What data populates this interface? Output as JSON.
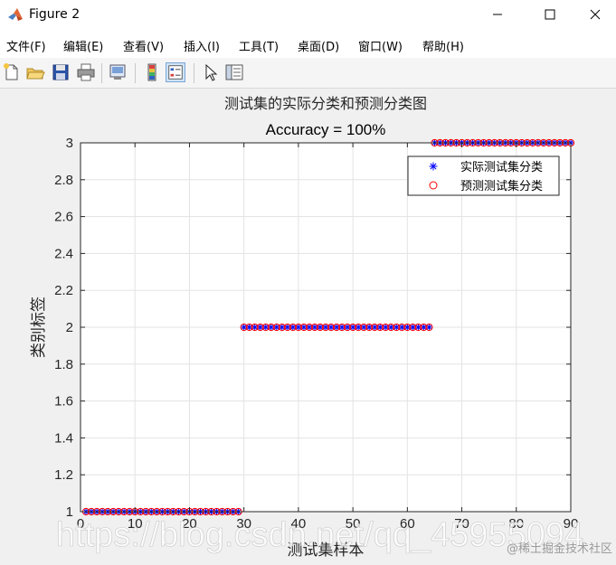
{
  "window": {
    "title": "Figure 2",
    "minimize_icon": "minimize-icon",
    "maximize_icon": "maximize-icon",
    "close_icon": "close-icon"
  },
  "menu": [
    {
      "label": "文件(F)"
    },
    {
      "label": "编辑(E)"
    },
    {
      "label": "查看(V)"
    },
    {
      "label": "插入(I)"
    },
    {
      "label": "工具(T)"
    },
    {
      "label": "桌面(D)"
    },
    {
      "label": "窗口(W)"
    },
    {
      "label": "帮助(H)"
    }
  ],
  "toolbar": {
    "icons": [
      "new-figure-icon",
      "open-file-icon",
      "save-icon",
      "print-icon",
      "link-plot-icon",
      "colorbar-icon",
      "legend-icon",
      "pointer-icon",
      "property-inspector-icon"
    ]
  },
  "chart_data": {
    "type": "scatter",
    "title": "测试集的实际分类和预测分类图",
    "subtitle": "Accuracy = 100%",
    "xlabel": "测试集样本",
    "ylabel": "类别标签",
    "xlim": [
      0,
      90
    ],
    "ylim": [
      1,
      3
    ],
    "xticks": [
      "0",
      "10",
      "20",
      "30",
      "40",
      "50",
      "60",
      "70",
      "80",
      "90"
    ],
    "yticks": [
      "1",
      "1.2",
      "1.4",
      "1.6",
      "1.8",
      "2",
      "2.2",
      "2.4",
      "2.6",
      "2.8",
      "3"
    ],
    "grid": true,
    "legend_position": "top-right",
    "series": [
      {
        "name": "实际测试集分类",
        "marker": "*",
        "color": "#0000ff",
        "segments": [
          {
            "x_start": 1,
            "x_end": 29,
            "y": 1
          },
          {
            "x_start": 30,
            "x_end": 64,
            "y": 2
          },
          {
            "x_start": 65,
            "x_end": 90,
            "y": 3
          }
        ]
      },
      {
        "name": "预测测试集分类",
        "marker": "o",
        "color": "#ff0000",
        "segments": [
          {
            "x_start": 1,
            "x_end": 29,
            "y": 1
          },
          {
            "x_start": 30,
            "x_end": 64,
            "y": 2
          },
          {
            "x_start": 65,
            "x_end": 90,
            "y": 3
          }
        ]
      }
    ]
  },
  "watermark": {
    "url": "https://blog.csdn.net/qq_45955094",
    "brand": "@稀土掘金技术社区"
  }
}
